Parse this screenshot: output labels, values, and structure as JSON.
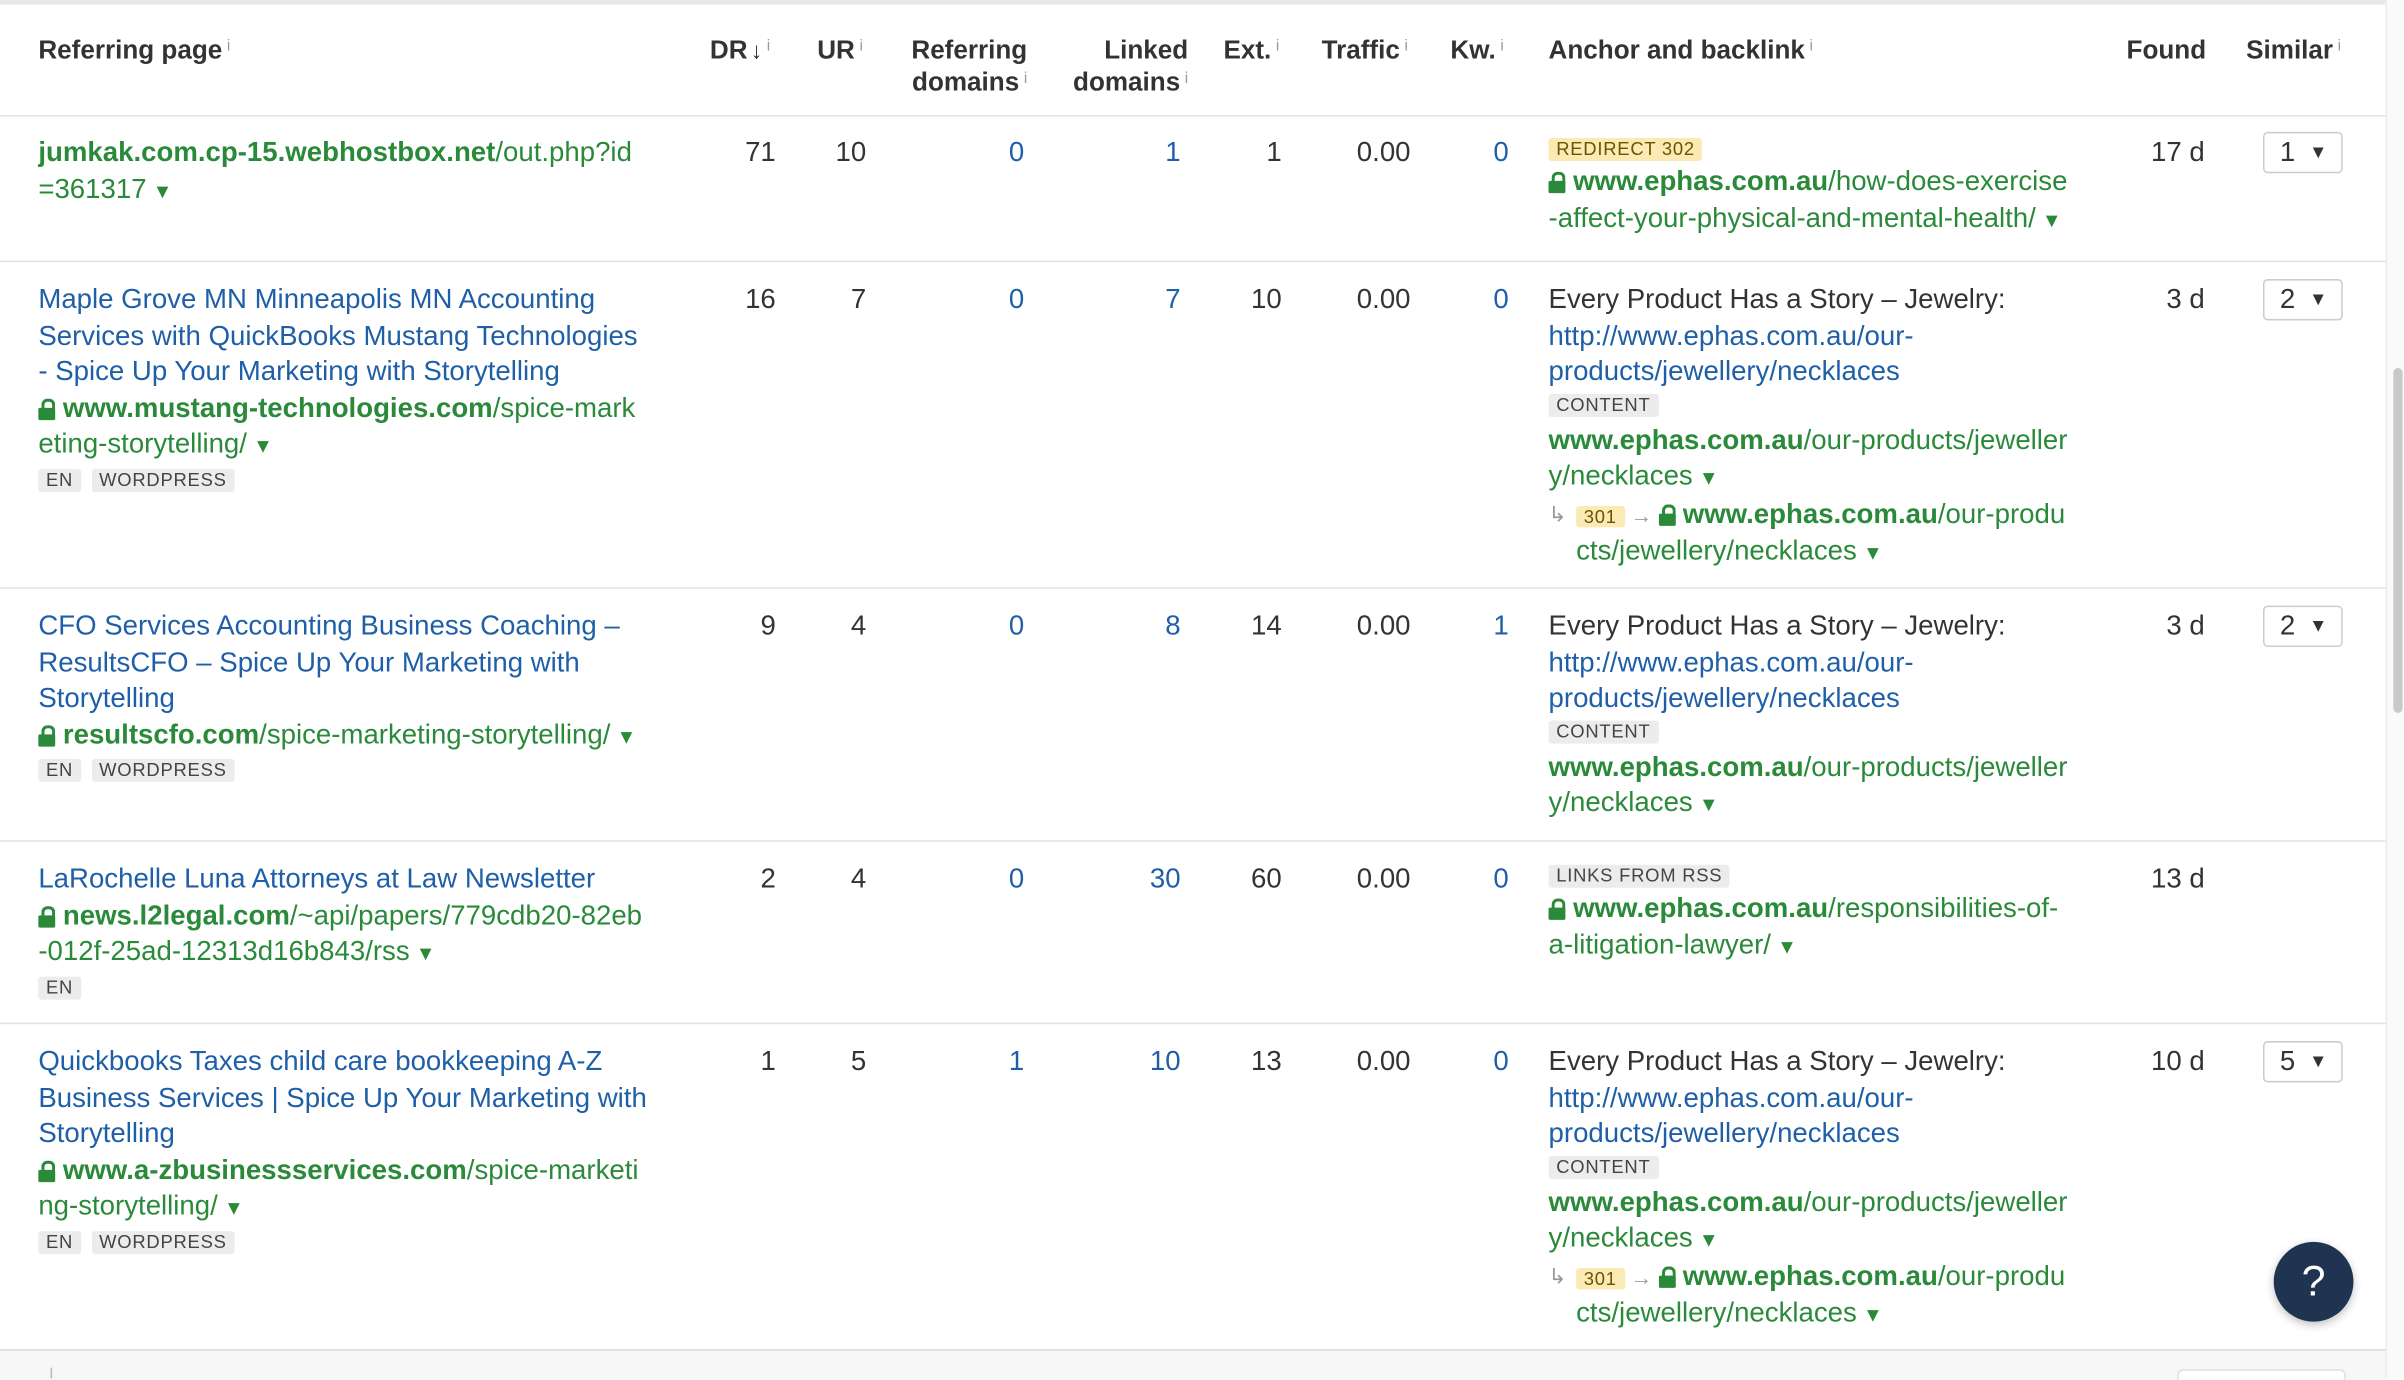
{
  "headers": {
    "referring_page": "Referring page",
    "dr": "DR",
    "ur": "UR",
    "referring_domains_1": "Referring",
    "referring_domains_2": "domains",
    "linked_domains_1": "Linked",
    "linked_domains_2": "domains",
    "ext": "Ext.",
    "traffic": "Traffic",
    "kw": "Kw.",
    "anchor_backlink": "Anchor and backlink",
    "found": "Found",
    "similar": "Similar",
    "info_glyph": "i",
    "sort_glyph": "↓"
  },
  "rows": [
    {
      "title": "",
      "url_host": "jumkak.com.cp-15.webhostbox.net",
      "url_path_1": "/out.php?id",
      "url_path_2": "=361317",
      "tags": [],
      "dr": "71",
      "ur": "10",
      "ref_domains": "0",
      "linked_domains": "1",
      "ext": "1",
      "traffic": "0.00",
      "kw": "0",
      "anchor_tag": "REDIRECT 302",
      "backlink_host": "www.ephas.com.au",
      "backlink_path_1": "/how-does-exercise",
      "backlink_path_2": "-affect-your-physical-and-mental-health/",
      "found": "17 d",
      "similar": "1"
    },
    {
      "title_1": "Maple Grove MN Minneapolis MN Accounting",
      "title_2": "Services with QuickBooks Mustang Technologies",
      "title_3": "- Spice Up Your Marketing with Storytelling",
      "url_host": "www.mustang-technologies.com",
      "url_path_1": "/spice-mark",
      "url_path_2": "eting-storytelling/",
      "tags": [
        "EN",
        "WORDPRESS"
      ],
      "dr": "16",
      "ur": "7",
      "ref_domains": "0",
      "linked_domains": "7",
      "ext": "10",
      "traffic": "0.00",
      "kw": "0",
      "anchor_text": "Every Product Has a Story – Jewelry:",
      "anchor_url_1": "http://www.ephas.com.au/our-",
      "anchor_url_2": "products/jewellery/necklaces",
      "anchor_tag": "CONTENT",
      "backlink_host": "www.ephas.com.au",
      "backlink_path_1": "/our-products/jeweller",
      "backlink_path_2": "y/necklaces",
      "redirect_code": "301",
      "redirect_host": "www.ephas.com.au",
      "redirect_path_1": "/our-produ",
      "redirect_path_2": "cts/jewellery/necklaces",
      "found": "3 d",
      "similar": "2"
    },
    {
      "title_1": "CFO Services Accounting Business Coaching –",
      "title_2": "ResultsCFO – Spice Up Your Marketing with",
      "title_3": "Storytelling",
      "url_host": "resultscfo.com",
      "url_path_1": "/spice-marketing-storytelling/",
      "tags": [
        "EN",
        "WORDPRESS"
      ],
      "dr": "9",
      "ur": "4",
      "ref_domains": "0",
      "linked_domains": "8",
      "ext": "14",
      "traffic": "0.00",
      "kw": "1",
      "anchor_text": "Every Product Has a Story – Jewelry:",
      "anchor_url_1": "http://www.ephas.com.au/our-",
      "anchor_url_2": "products/jewellery/necklaces",
      "anchor_tag": "CONTENT",
      "backlink_host": "www.ephas.com.au",
      "backlink_path_1": "/our-products/jeweller",
      "backlink_path_2": "y/necklaces",
      "found": "3 d",
      "similar": "2"
    },
    {
      "title_1": "LaRochelle Luna Attorneys at Law Newsletter",
      "url_host": "news.l2legal.com",
      "url_path_1": "/~api/papers/779cdb20-82eb",
      "url_path_2": "-012f-25ad-12313d16b843/rss",
      "tags": [
        "EN"
      ],
      "dr": "2",
      "ur": "4",
      "ref_domains": "0",
      "linked_domains": "30",
      "ext": "60",
      "traffic": "0.00",
      "kw": "0",
      "anchor_tag": "LINKS FROM RSS",
      "backlink_host": "www.ephas.com.au",
      "backlink_path_1": "/responsibilities-of-",
      "backlink_path_2": "a-litigation-lawyer/",
      "found": "13 d"
    },
    {
      "title_1": "Quickbooks Taxes child care bookkeeping A-Z",
      "title_2": "Business Services | Spice Up Your Marketing with",
      "title_3": "Storytelling",
      "url_host": "www.a-zbusinessservices.com",
      "url_path_1": "/spice-marketi",
      "url_path_2": "ng-storytelling/",
      "tags": [
        "EN",
        "WORDPRESS"
      ],
      "dr": "1",
      "ur": "5",
      "ref_domains": "1",
      "linked_domains": "10",
      "ext": "13",
      "traffic": "0.00",
      "kw": "0",
      "anchor_text": "Every Product Has a Story – Jewelry:",
      "anchor_url_1": "http://www.ephas.com.au/our-",
      "anchor_url_2": "products/jewellery/necklaces",
      "anchor_tag": "CONTENT",
      "backlink_host": "www.ephas.com.au",
      "backlink_path_1": "/our-products/jeweller",
      "backlink_path_2": "y/necklaces",
      "redirect_code": "301",
      "redirect_host": "www.ephas.com.au",
      "redirect_path_1": "/our-produ",
      "redirect_path_2": "cts/jewellery/necklaces",
      "found": "10 d",
      "similar": "5"
    }
  ],
  "help_button": "?",
  "colors": {
    "link_blue": "#1f5fa8",
    "url_green": "#2a8a3a",
    "help_bg": "#1f3450"
  }
}
